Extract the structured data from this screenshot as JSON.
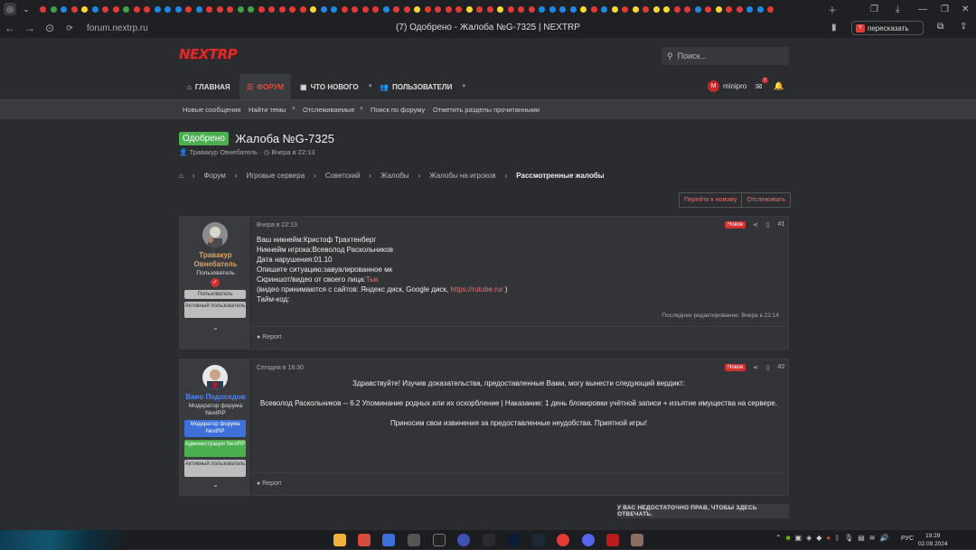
{
  "browser": {
    "url": "forum.nextrp.ru",
    "page_title": "(7) Одобрено - Жалоба №G-7325 | NEXTRP",
    "translate_label": "пересказать",
    "tab_colors": [
      "#e53935",
      "#43a047",
      "#1e88e5",
      "#e53935",
      "#fdd835",
      "#1e88e5",
      "#e53935",
      "#e53935",
      "#43a047",
      "#e53935",
      "#e53935",
      "#1e88e5",
      "#1e88e5",
      "#1e88e5",
      "#e53935",
      "#1e88e5",
      "#e53935",
      "#e53935",
      "#e53935",
      "#43a047",
      "#43a047",
      "#e53935",
      "#e53935",
      "#e53935",
      "#e53935",
      "#e53935",
      "#fdd835",
      "#1e88e5",
      "#1e88e5",
      "#e53935",
      "#e53935",
      "#e53935",
      "#e53935",
      "#1e88e5",
      "#e53935",
      "#e53935",
      "#fdd835",
      "#e53935",
      "#e53935",
      "#e53935",
      "#e53935",
      "#fdd835",
      "#e53935",
      "#e53935",
      "#fdd835",
      "#e53935",
      "#e53935",
      "#e53935",
      "#1e88e5",
      "#1e88e5",
      "#1e88e5",
      "#1e88e5",
      "#fdd835",
      "#e53935",
      "#1e88e5",
      "#fdd835",
      "#e53935",
      "#fdd835",
      "#e53935",
      "#fdd835",
      "#fdd835",
      "#e53935",
      "#e53935",
      "#1e88e5",
      "#e53935",
      "#fdd835",
      "#e53935",
      "#e53935",
      "#1e88e5",
      "#1e88e5",
      "#e53935"
    ]
  },
  "site": {
    "logo": "NEXTRP",
    "search_placeholder": "Поиск...",
    "nav": {
      "home": "ГЛАВНАЯ",
      "forum": "ФОРУМ",
      "whats_new": "ЧТО НОВОГО",
      "users": "ПОЛЬЗОВАТЕЛИ"
    },
    "user": {
      "name": "minipro",
      "initial": "M",
      "inbox_count": "7"
    },
    "subnav": [
      "Новые сообщения",
      "Найти темы",
      "Отслеживаемые",
      "Поиск по форуму",
      "Отметить разделы прочитанными"
    ]
  },
  "thread": {
    "prefix": "Одобрено",
    "title": "Жалоба №G-7325",
    "author": "Травакур Овнебатель",
    "date": "Вчера в 22:13",
    "breadcrumbs": [
      "Форум",
      "Игровые сервера",
      "Советский",
      "Жалобы",
      "Жалобы на игроков",
      "Рассмотренные жалобы"
    ],
    "buttons": {
      "goto_new": "Перейти к новому",
      "watch": "Отслеживать"
    }
  },
  "posts": [
    {
      "author": "Травакур Овнебатель",
      "role": "Пользователь",
      "banners": [
        "Пользователь",
        "Активный пользователь"
      ],
      "date": "Вчера в 22:13",
      "new_label": "Новое",
      "number": "#1",
      "lines": [
        "Ваш никнейм:Кристоф Трахтенберг",
        "Никнейм игрока:Всеволод Раскольников",
        "Дата нарушения:01.10",
        "Опишите ситуацию:завуалированное мк"
      ],
      "proof_label": "Скриншот/видео от своего лица:",
      "proof_link": "Тык",
      "video_note_pre": "(видео принимаются с сайтов: Яндекс диск, Google диск, ",
      "video_link": "https://rutube.ru/",
      "video_note_post": " )",
      "timecode": "Тайм-код:",
      "edited": "Последнее редактирование: Вчера в 22:14",
      "report": "Report"
    },
    {
      "author": "Вано Подоседов",
      "role": "Модератор форума NextRP",
      "banners": [
        "Модератор форума NextRP",
        "Администрация NextRP",
        "Активный пользователь"
      ],
      "date": "Сегодня в 18:30",
      "new_label": "Новое",
      "number": "#2",
      "p1": "Здравствуйте! Изучив доказательства, предоставленные Вами, могу вынести следующий вердикт:",
      "p2": "Всеволод Раскольников -- 6.2 Упоминание родных или их оскорбление | Наказание: 1 день блокировки учётной записи + изъятие имущества на сервере.",
      "p3": "Приносим свои извинения за предоставленные неудобства. Приятной игры!",
      "report": "Report"
    }
  ],
  "no_permission": "У ВАС НЕДОСТАТОЧНО ПРАВ, ЧТОБЫ ЗДЕСЬ ОТВЕЧАТЬ.",
  "taskbar": {
    "lang": "РУС",
    "time": "19:29",
    "date": "02.09.2024"
  }
}
